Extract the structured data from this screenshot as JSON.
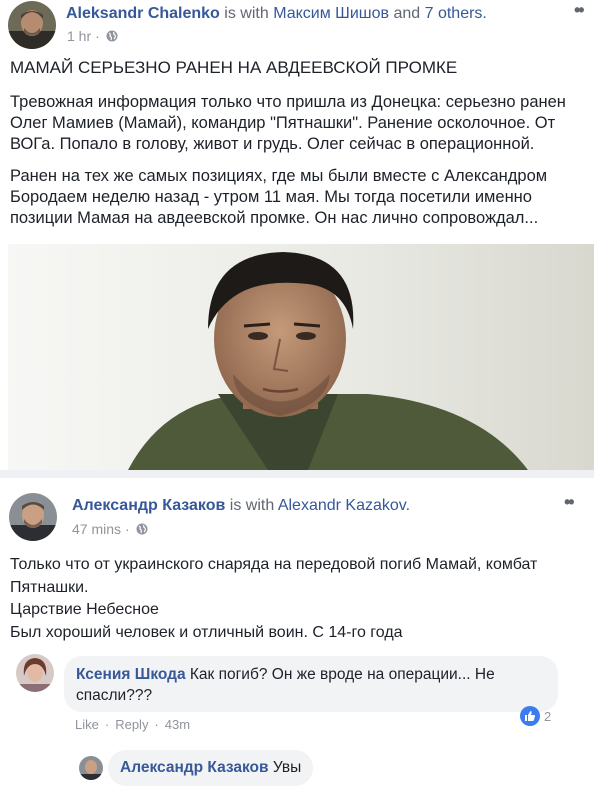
{
  "post1": {
    "author": "Aleksandr Chalenko",
    "with_text": "is with",
    "tagged": "Максим Шишов",
    "and_text": "and",
    "others": "7 others.",
    "time": "1 hr",
    "privacy_icon": "globe-icon",
    "menu_icon": "more-icon",
    "title": "МАМАЙ СЕРЬЕЗНО РАНЕН НА АВДЕЕВСКОЙ ПРОМКЕ",
    "paragraph1": "Тревожная информация только что пришла из Донецка: серьезно ранен Олег Мамиев (Мамай), командир \"Пятнашки\". Ранение осколочное. От ВОГа. Попало в голову, живот и грудь. Олег сейчас в операционной.",
    "paragraph2": "Ранен на тех же самых позициях, где мы были вместе с Александром Бородаем неделю назад - утром 11 мая. Мы тогда посетили именно позиции Мамая на авдеевской промке. Он нас лично сопровождал..."
  },
  "post2": {
    "author": "Александр Казаков",
    "with_text": "is with",
    "tagged": "Alexandr Kazakov.",
    "time": "47 mins",
    "privacy_icon": "globe-icon",
    "menu_icon": "more-icon",
    "line1": "Только что от украинского снаряда на передовой погиб Мамай, комбат Пятнашки.",
    "line2": "Царствие Небесное",
    "line3": "Был хороший человек и отличный воин. С 14-го года"
  },
  "comment": {
    "author": "Ксения Шкода",
    "text": "Как погиб? Он же вроде на операции... Не спасли???",
    "like": "Like",
    "separator": "·",
    "reply": "Reply",
    "time": "43m",
    "reaction_icon": "thumbs-up-icon",
    "reaction_count": "2"
  },
  "reply": {
    "author": "Александр Казаков",
    "text": "Увы"
  },
  "colors": {
    "link": "#365899",
    "meta": "#90949c",
    "bubble": "#f2f3f5",
    "like_blue": "#3b7df0"
  }
}
